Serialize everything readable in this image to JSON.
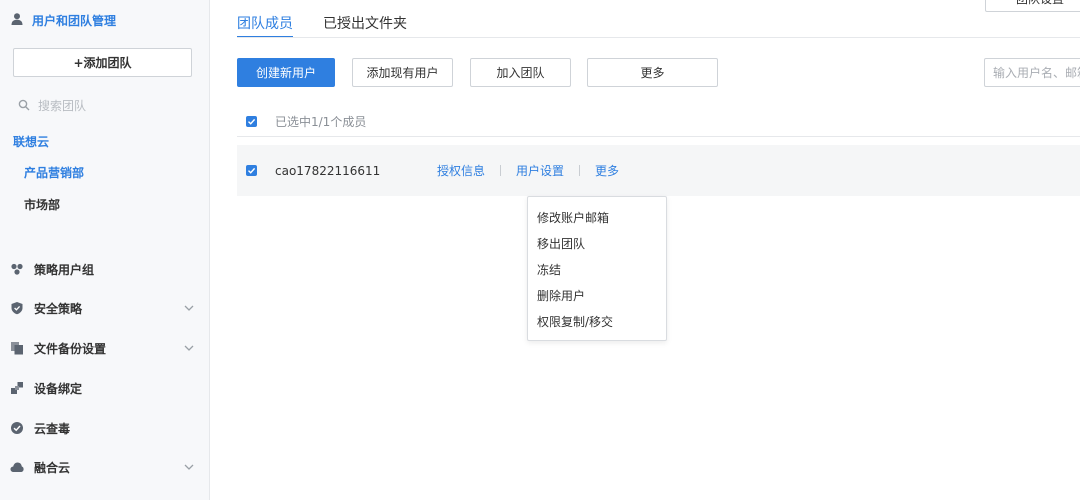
{
  "sidebar": {
    "header": {
      "icon": "user-icon",
      "title": "用户和团队管理"
    },
    "add_team_label": "+添加团队",
    "search": {
      "icon": "search-icon",
      "placeholder": "搜索团队"
    },
    "team_root": "联想云",
    "teams": [
      {
        "label": "产品营销部",
        "active": true
      },
      {
        "label": "市场部",
        "active": false
      }
    ],
    "nav": [
      {
        "label": "策略用户组",
        "icon": "user-group-icon",
        "expandable": false
      },
      {
        "label": "安全策略",
        "icon": "shield-icon",
        "expandable": true
      },
      {
        "label": "文件备份设置",
        "icon": "copy-icon",
        "expandable": true
      },
      {
        "label": "设备绑定",
        "icon": "device-link-icon",
        "expandable": false
      },
      {
        "label": "云查毒",
        "icon": "virus-scan-icon",
        "expandable": false
      },
      {
        "label": "融合云",
        "icon": "cloud-icon",
        "expandable": true
      }
    ]
  },
  "tabs": [
    {
      "label": "团队成员",
      "active": true
    },
    {
      "label": "已授出文件夹",
      "active": false
    }
  ],
  "team_settings_label": "团队设置",
  "toolbar": {
    "create_user": "创建新用户",
    "add_existing": "添加现有用户",
    "join_team": "加入团队",
    "more": "更多",
    "search_placeholder": "输入用户名、邮箱"
  },
  "selection_text": "已选中1/1个成员",
  "members": [
    {
      "name": "cao17822116611",
      "actions": [
        "授权信息",
        "用户设置",
        "更多"
      ]
    }
  ],
  "more_menu": [
    "修改账户邮箱",
    "移出团队",
    "冻结",
    "删除用户",
    "权限复制/移交"
  ],
  "colors": {
    "accent": "#2f7fe0",
    "sidebar_bg": "#f7f8fa"
  }
}
